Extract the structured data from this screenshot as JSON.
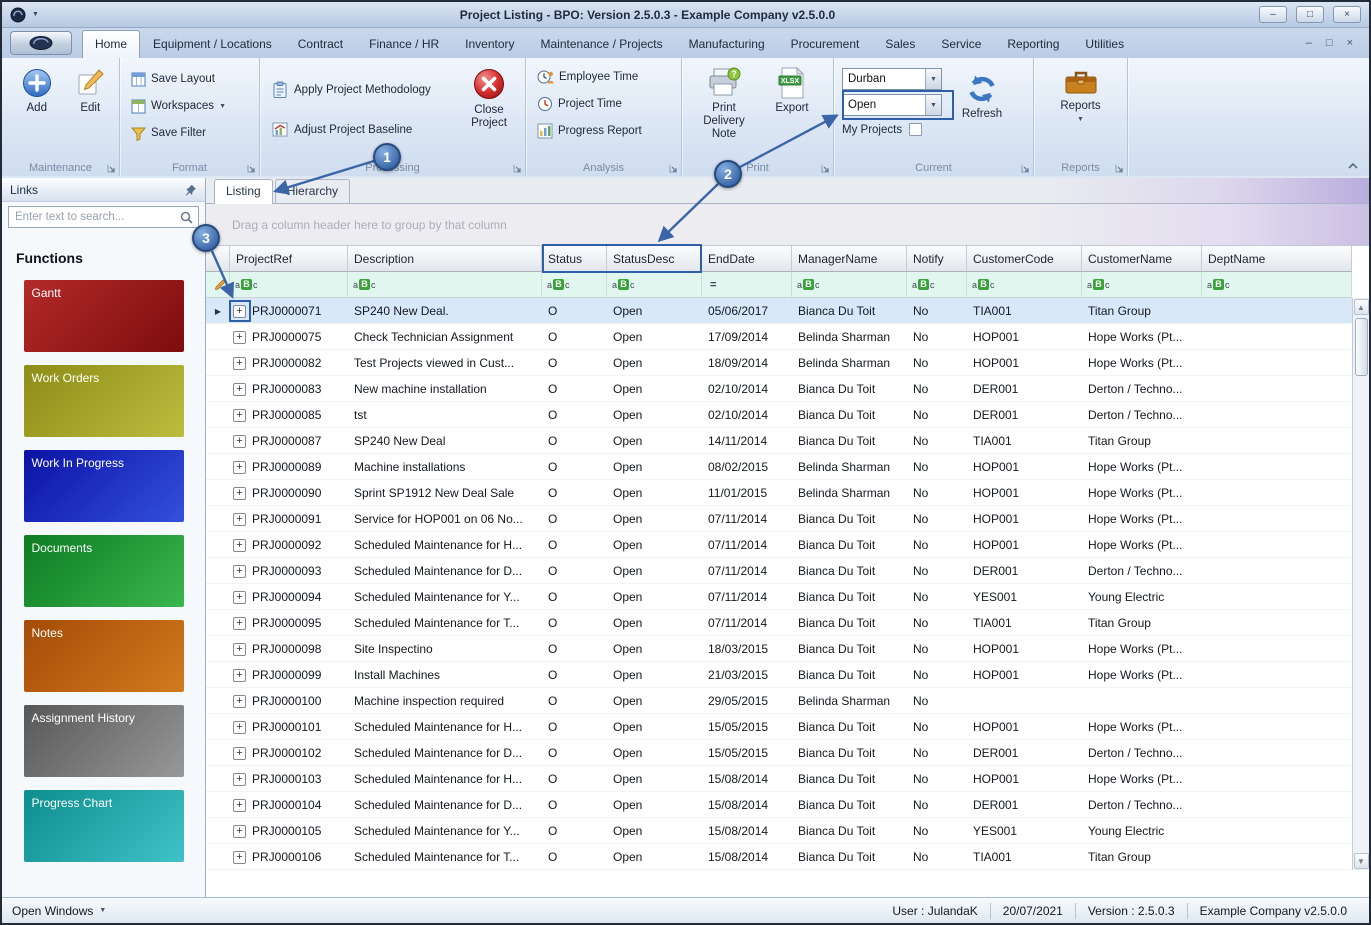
{
  "icons": {
    "caret_down": "▼",
    "minimize": "–",
    "maximize": "□",
    "close": "×",
    "plus": "+",
    "row_arrow": "▶",
    "scroll_up": "▲",
    "scroll_down": "▼"
  },
  "titlebar": {
    "title": "Project Listing - BPO: Version 2.5.0.3 - Example Company v2.5.0.0"
  },
  "ribbon": {
    "tabs": [
      "Home",
      "Equipment / Locations",
      "Contract",
      "Finance / HR",
      "Inventory",
      "Maintenance / Projects",
      "Manufacturing",
      "Procurement",
      "Sales",
      "Service",
      "Reporting",
      "Utilities"
    ],
    "active_tab": "Home",
    "groups": {
      "maintenance": {
        "caption": "Maintenance",
        "add": "Add",
        "edit": "Edit"
      },
      "format": {
        "caption": "Format",
        "save_layout": "Save Layout",
        "workspaces": "Workspaces",
        "save_filter": "Save Filter"
      },
      "processing": {
        "caption": "Processing",
        "apply_methodology": "Apply Project Methodology",
        "adjust_baseline": "Adjust Project Baseline",
        "close_project": "Close Project"
      },
      "analysis": {
        "caption": "Analysis",
        "employee_time": "Employee Time",
        "project_time": "Project Time",
        "progress_report": "Progress Report"
      },
      "print": {
        "caption": "Print",
        "print_delivery_note": "Print Delivery Note",
        "export": "Export"
      },
      "current": {
        "caption": "Current",
        "site_value": "Durban",
        "status_value": "Open",
        "my_projects_label": "My Projects",
        "my_projects_checked": false,
        "refresh": "Refresh"
      },
      "reports": {
        "caption": "Reports",
        "reports": "Reports"
      }
    }
  },
  "sidebar": {
    "header": "Links",
    "search_placeholder": "Enter text to search...",
    "functions_title": "Functions",
    "functions": [
      {
        "label": "Gantt",
        "color_from": "#b32a2a",
        "color_to": "#7d0c0c"
      },
      {
        "label": "Work Orders",
        "color_from": "#8d8d17",
        "color_to": "#bcbc3e"
      },
      {
        "label": "Work In Progress",
        "color_from": "#0b12a5",
        "color_to": "#3450dd"
      },
      {
        "label": "Documents",
        "color_from": "#0d7c22",
        "color_to": "#3bb64f"
      },
      {
        "label": "Notes",
        "color_from": "#a44c08",
        "color_to": "#d07b1e"
      },
      {
        "label": "Assignment History",
        "color_from": "#575757",
        "color_to": "#989898"
      },
      {
        "label": "Progress Chart",
        "color_from": "#0e8d8d",
        "color_to": "#3fc2c8"
      }
    ]
  },
  "main": {
    "tabs": [
      "Listing",
      "Hierarchy"
    ],
    "active_tab": "Listing",
    "group_panel_text": "Drag a column header here to group by that column",
    "grid": {
      "columns": [
        {
          "key": "projectRef",
          "label": "ProjectRef",
          "filter": "abc"
        },
        {
          "key": "description",
          "label": "Description",
          "filter": "abc"
        },
        {
          "key": "status",
          "label": "Status",
          "filter": "abc"
        },
        {
          "key": "statusDesc",
          "label": "StatusDesc",
          "filter": "abc"
        },
        {
          "key": "endDate",
          "label": "EndDate",
          "filter": "equals"
        },
        {
          "key": "managerName",
          "label": "ManagerName",
          "filter": "abc"
        },
        {
          "key": "notify",
          "label": "Notify",
          "filter": "abc"
        },
        {
          "key": "customerCode",
          "label": "CustomerCode",
          "filter": "abc"
        },
        {
          "key": "customerName",
          "label": "CustomerName",
          "filter": "abc"
        },
        {
          "key": "deptName",
          "label": "DeptName",
          "filter": "abc"
        }
      ],
      "filter_icons": {
        "abc": [
          "a",
          "B",
          "c"
        ],
        "equals": "="
      },
      "rows": [
        {
          "selected": true,
          "projectRef": "PRJ0000071",
          "description": "SP240 New Deal.",
          "status": "O",
          "statusDesc": "Open",
          "endDate": "05/06/2017",
          "managerName": "Bianca Du Toit",
          "notify": "No",
          "customerCode": "TIA001",
          "customerName": "Titan Group",
          "deptName": ""
        },
        {
          "projectRef": "PRJ0000075",
          "description": "Check Technician Assignment",
          "status": "O",
          "statusDesc": "Open",
          "endDate": "17/09/2014",
          "managerName": "Belinda Sharman",
          "notify": "No",
          "customerCode": "HOP001",
          "customerName": "Hope Works (Pt...",
          "deptName": ""
        },
        {
          "projectRef": "PRJ0000082",
          "description": "Test Projects viewed in Cust...",
          "status": "O",
          "statusDesc": "Open",
          "endDate": "18/09/2014",
          "managerName": "Belinda Sharman",
          "notify": "No",
          "customerCode": "HOP001",
          "customerName": "Hope Works (Pt...",
          "deptName": ""
        },
        {
          "projectRef": "PRJ0000083",
          "description": "New machine installation",
          "status": "O",
          "statusDesc": "Open",
          "endDate": "02/10/2014",
          "managerName": "Bianca Du Toit",
          "notify": "No",
          "customerCode": "DER001",
          "customerName": "Derton / Techno...",
          "deptName": ""
        },
        {
          "projectRef": "PRJ0000085",
          "description": "tst",
          "status": "O",
          "statusDesc": "Open",
          "endDate": "02/10/2014",
          "managerName": "Bianca Du Toit",
          "notify": "No",
          "customerCode": "DER001",
          "customerName": "Derton / Techno...",
          "deptName": ""
        },
        {
          "projectRef": "PRJ0000087",
          "description": "SP240 New Deal",
          "status": "O",
          "statusDesc": "Open",
          "endDate": "14/11/2014",
          "managerName": "Bianca Du Toit",
          "notify": "No",
          "customerCode": "TIA001",
          "customerName": "Titan Group",
          "deptName": ""
        },
        {
          "projectRef": "PRJ0000089",
          "description": "Machine installations",
          "status": "O",
          "statusDesc": "Open",
          "endDate": "08/02/2015",
          "managerName": "Belinda Sharman",
          "notify": "No",
          "customerCode": "HOP001",
          "customerName": "Hope Works (Pt...",
          "deptName": ""
        },
        {
          "projectRef": "PRJ0000090",
          "description": "Sprint SP1912 New Deal Sale",
          "status": "O",
          "statusDesc": "Open",
          "endDate": "11/01/2015",
          "managerName": "Belinda Sharman",
          "notify": "No",
          "customerCode": "HOP001",
          "customerName": "Hope Works (Pt...",
          "deptName": ""
        },
        {
          "projectRef": "PRJ0000091",
          "description": "Service for HOP001 on 06 No...",
          "status": "O",
          "statusDesc": "Open",
          "endDate": "07/11/2014",
          "managerName": "Bianca Du Toit",
          "notify": "No",
          "customerCode": "HOP001",
          "customerName": "Hope Works (Pt...",
          "deptName": ""
        },
        {
          "projectRef": "PRJ0000092",
          "description": "Scheduled Maintenance for H...",
          "status": "O",
          "statusDesc": "Open",
          "endDate": "07/11/2014",
          "managerName": "Bianca Du Toit",
          "notify": "No",
          "customerCode": "HOP001",
          "customerName": "Hope Works (Pt...",
          "deptName": ""
        },
        {
          "projectRef": "PRJ0000093",
          "description": "Scheduled Maintenance for D...",
          "status": "O",
          "statusDesc": "Open",
          "endDate": "07/11/2014",
          "managerName": "Bianca Du Toit",
          "notify": "No",
          "customerCode": "DER001",
          "customerName": "Derton / Techno...",
          "deptName": ""
        },
        {
          "projectRef": "PRJ0000094",
          "description": "Scheduled Maintenance for Y...",
          "status": "O",
          "statusDesc": "Open",
          "endDate": "07/11/2014",
          "managerName": "Bianca Du Toit",
          "notify": "No",
          "customerCode": "YES001",
          "customerName": "Young Electric",
          "deptName": ""
        },
        {
          "projectRef": "PRJ0000095",
          "description": "Scheduled Maintenance for T...",
          "status": "O",
          "statusDesc": "Open",
          "endDate": "07/11/2014",
          "managerName": "Bianca Du Toit",
          "notify": "No",
          "customerCode": "TIA001",
          "customerName": "Titan Group",
          "deptName": ""
        },
        {
          "projectRef": "PRJ0000098",
          "description": "Site Inspectino",
          "status": "O",
          "statusDesc": "Open",
          "endDate": "18/03/2015",
          "managerName": "Bianca Du Toit",
          "notify": "No",
          "customerCode": "HOP001",
          "customerName": "Hope Works (Pt...",
          "deptName": ""
        },
        {
          "projectRef": "PRJ0000099",
          "description": "Install Machines",
          "status": "O",
          "statusDesc": "Open",
          "endDate": "21/03/2015",
          "managerName": "Bianca Du Toit",
          "notify": "No",
          "customerCode": "HOP001",
          "customerName": "Hope Works (Pt...",
          "deptName": ""
        },
        {
          "projectRef": "PRJ0000100",
          "description": "Machine inspection required",
          "status": "O",
          "statusDesc": "Open",
          "endDate": "29/05/2015",
          "managerName": "Belinda Sharman",
          "notify": "No",
          "customerCode": "",
          "customerName": "",
          "deptName": ""
        },
        {
          "projectRef": "PRJ0000101",
          "description": "Scheduled Maintenance for H...",
          "status": "O",
          "statusDesc": "Open",
          "endDate": "15/05/2015",
          "managerName": "Bianca Du Toit",
          "notify": "No",
          "customerCode": "HOP001",
          "customerName": "Hope Works (Pt...",
          "deptName": ""
        },
        {
          "projectRef": "PRJ0000102",
          "description": "Scheduled Maintenance for D...",
          "status": "O",
          "statusDesc": "Open",
          "endDate": "15/05/2015",
          "managerName": "Bianca Du Toit",
          "notify": "No",
          "customerCode": "DER001",
          "customerName": "Derton / Techno...",
          "deptName": ""
        },
        {
          "projectRef": "PRJ0000103",
          "description": "Scheduled Maintenance for H...",
          "status": "O",
          "statusDesc": "Open",
          "endDate": "15/08/2014",
          "managerName": "Bianca Du Toit",
          "notify": "No",
          "customerCode": "HOP001",
          "customerName": "Hope Works (Pt...",
          "deptName": ""
        },
        {
          "projectRef": "PRJ0000104",
          "description": "Scheduled Maintenance for D...",
          "status": "O",
          "statusDesc": "Open",
          "endDate": "15/08/2014",
          "managerName": "Bianca Du Toit",
          "notify": "No",
          "customerCode": "DER001",
          "customerName": "Derton / Techno...",
          "deptName": ""
        },
        {
          "projectRef": "PRJ0000105",
          "description": "Scheduled Maintenance for Y...",
          "status": "O",
          "statusDesc": "Open",
          "endDate": "15/08/2014",
          "managerName": "Bianca Du Toit",
          "notify": "No",
          "customerCode": "YES001",
          "customerName": "Young Electric",
          "deptName": ""
        },
        {
          "projectRef": "PRJ0000106",
          "description": "Scheduled Maintenance for T...",
          "status": "O",
          "statusDesc": "Open",
          "endDate": "15/08/2014",
          "managerName": "Bianca Du Toit",
          "notify": "No",
          "customerCode": "TIA001",
          "customerName": "Titan Group",
          "deptName": ""
        }
      ]
    }
  },
  "statusbar": {
    "open_windows": "Open Windows",
    "items": [
      "User : JulandaK",
      "20/07/2021",
      "Version : 2.5.0.3",
      "Example Company v2.5.0.0"
    ]
  },
  "annotations": {
    "labels": [
      "1",
      "2",
      "3"
    ],
    "color": "#3a66a8"
  }
}
